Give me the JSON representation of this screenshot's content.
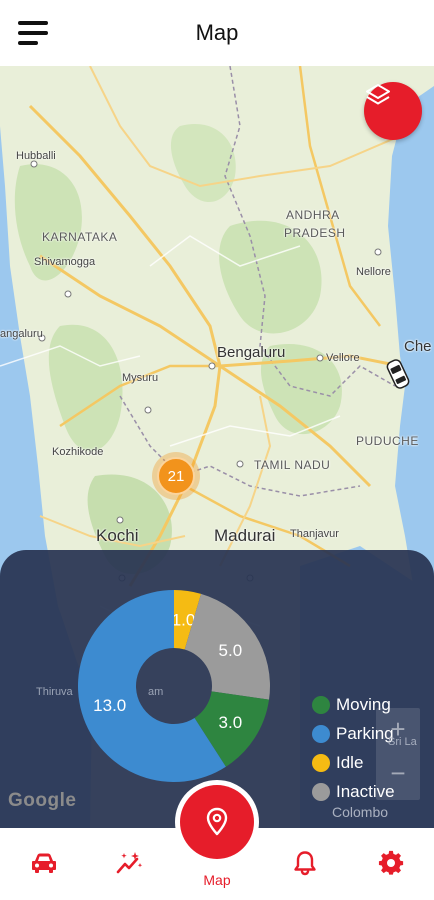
{
  "app_bar": {
    "title": "Map",
    "menu_icon": "hamburger-menu-icon"
  },
  "map": {
    "labels": {
      "hubballi": "Hubballi",
      "karnataka": "KARNATAKA",
      "shivamogga": "Shivamogga",
      "andhra": "ANDHRA",
      "pradesh": "PRADESH",
      "nellore": "Nellore",
      "mangaluru": "angaluru",
      "bengaluru": "Bengaluru",
      "vellore": "Vellore",
      "chennai": "Che",
      "mysuru": "Mysuru",
      "kozhikode": "Kozhikode",
      "puducherry": "PUDUCHE",
      "tamil_nadu": "TAMIL NADU",
      "kochi": "Kochi",
      "madurai": "Madurai",
      "thanjavur": "Thanjavur",
      "thiruvananthapuram_a": "Thiruva",
      "thiruvananthapuram_b": "am",
      "sri_lanka": "Sri La",
      "colombo": "Colombo"
    },
    "layers_icon": "layers-icon",
    "cluster_count": "21",
    "google_logo": "Google",
    "zoom_in": "+",
    "zoom_out": "−"
  },
  "status_summary": {
    "chart_data": {
      "type": "pie",
      "categories": [
        "Moving",
        "Parking",
        "Idle",
        "Inactive"
      ],
      "values": [
        3.0,
        13.0,
        1.0,
        5.0
      ],
      "value_labels": [
        "3.0",
        "13.0",
        "1.0",
        "5.0"
      ],
      "colors": [
        "#2e8540",
        "#3d8bd0",
        "#f5bb13",
        "#9b9b9b"
      ],
      "legend_position": "right"
    }
  },
  "bottom_nav": {
    "items": [
      {
        "icon": "car-icon"
      },
      {
        "icon": "analytics-wand-icon"
      },
      {
        "icon": "bell-icon"
      },
      {
        "icon": "gear-icon"
      }
    ],
    "fab_icon": "map-pin-icon",
    "fab_label": "Map",
    "accent_color": "#e61d2a"
  }
}
